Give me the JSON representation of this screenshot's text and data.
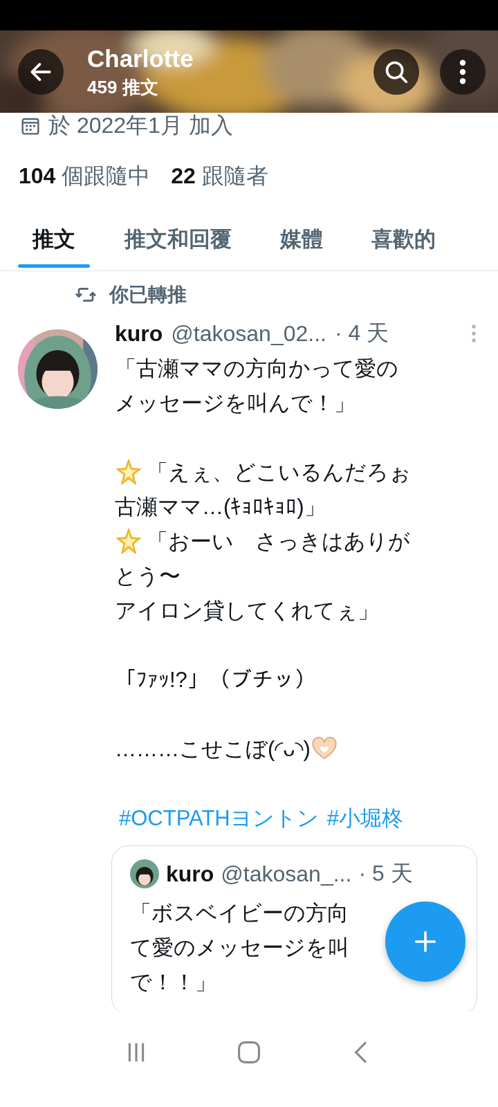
{
  "header": {
    "title": "Charlotte",
    "subtitle": "459 推文"
  },
  "profile": {
    "joined": "於 2022年1月 加入",
    "following_count": "104",
    "following_label": "個跟隨中",
    "followers_count": "22",
    "followers_label": "跟隨者"
  },
  "tabs": [
    {
      "label": "推文",
      "selected": true
    },
    {
      "label": "推文和回覆",
      "selected": false
    },
    {
      "label": "媒體",
      "selected": false
    },
    {
      "label": "喜歡的",
      "selected": false
    }
  ],
  "tweet": {
    "retweet_note": "你已轉推",
    "name": "kuro",
    "handle": "@takosan_02...",
    "time": "· 4 天",
    "paragraphs": [
      [
        {
          "kind": "plain",
          "text": "「古瀬ママの方向かって愛の"
        },
        {
          "kind": "plain",
          "text": "メッセージを叫んで！」"
        }
      ],
      [
        {
          "kind": "star",
          "text": "「えぇ、どこいるんだろぉ"
        },
        {
          "kind": "plain",
          "text": "古瀬ママ…(ｷｮﾛｷｮﾛ)」"
        },
        {
          "kind": "star",
          "text": "「おーい　さっきはありが"
        },
        {
          "kind": "plain",
          "text": "とう〜"
        },
        {
          "kind": "plain",
          "text": "アイロン貸してくれてぇ」"
        }
      ],
      [
        {
          "kind": "plain",
          "text": "「ﾌｧｯ!?」（ブチッ）"
        }
      ],
      [
        {
          "kind": "heart",
          "text": "………こせこぼ(◜ᴗ◝)"
        }
      ]
    ],
    "hashtags": [
      "#OCTPATHヨントン",
      "#小堀柊"
    ],
    "quote": {
      "name": "kuro",
      "handle": "@takosan_...",
      "time": "· 5 天",
      "lines": [
        "「ボスベイビーの方向",
        "て愛のメッセージを叫",
        "で！！」"
      ]
    }
  }
}
